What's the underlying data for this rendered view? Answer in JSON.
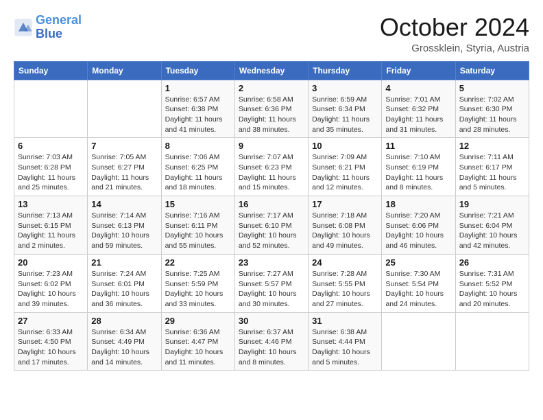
{
  "header": {
    "logo_line1": "General",
    "logo_line2": "Blue",
    "month": "October 2024",
    "location": "Grossklein, Styria, Austria"
  },
  "days_of_week": [
    "Sunday",
    "Monday",
    "Tuesday",
    "Wednesday",
    "Thursday",
    "Friday",
    "Saturday"
  ],
  "weeks": [
    [
      {
        "day": "",
        "info": ""
      },
      {
        "day": "",
        "info": ""
      },
      {
        "day": "1",
        "info": "Sunrise: 6:57 AM\nSunset: 6:38 PM\nDaylight: 11 hours and 41 minutes."
      },
      {
        "day": "2",
        "info": "Sunrise: 6:58 AM\nSunset: 6:36 PM\nDaylight: 11 hours and 38 minutes."
      },
      {
        "day": "3",
        "info": "Sunrise: 6:59 AM\nSunset: 6:34 PM\nDaylight: 11 hours and 35 minutes."
      },
      {
        "day": "4",
        "info": "Sunrise: 7:01 AM\nSunset: 6:32 PM\nDaylight: 11 hours and 31 minutes."
      },
      {
        "day": "5",
        "info": "Sunrise: 7:02 AM\nSunset: 6:30 PM\nDaylight: 11 hours and 28 minutes."
      }
    ],
    [
      {
        "day": "6",
        "info": "Sunrise: 7:03 AM\nSunset: 6:28 PM\nDaylight: 11 hours and 25 minutes."
      },
      {
        "day": "7",
        "info": "Sunrise: 7:05 AM\nSunset: 6:27 PM\nDaylight: 11 hours and 21 minutes."
      },
      {
        "day": "8",
        "info": "Sunrise: 7:06 AM\nSunset: 6:25 PM\nDaylight: 11 hours and 18 minutes."
      },
      {
        "day": "9",
        "info": "Sunrise: 7:07 AM\nSunset: 6:23 PM\nDaylight: 11 hours and 15 minutes."
      },
      {
        "day": "10",
        "info": "Sunrise: 7:09 AM\nSunset: 6:21 PM\nDaylight: 11 hours and 12 minutes."
      },
      {
        "day": "11",
        "info": "Sunrise: 7:10 AM\nSunset: 6:19 PM\nDaylight: 11 hours and 8 minutes."
      },
      {
        "day": "12",
        "info": "Sunrise: 7:11 AM\nSunset: 6:17 PM\nDaylight: 11 hours and 5 minutes."
      }
    ],
    [
      {
        "day": "13",
        "info": "Sunrise: 7:13 AM\nSunset: 6:15 PM\nDaylight: 11 hours and 2 minutes."
      },
      {
        "day": "14",
        "info": "Sunrise: 7:14 AM\nSunset: 6:13 PM\nDaylight: 10 hours and 59 minutes."
      },
      {
        "day": "15",
        "info": "Sunrise: 7:16 AM\nSunset: 6:11 PM\nDaylight: 10 hours and 55 minutes."
      },
      {
        "day": "16",
        "info": "Sunrise: 7:17 AM\nSunset: 6:10 PM\nDaylight: 10 hours and 52 minutes."
      },
      {
        "day": "17",
        "info": "Sunrise: 7:18 AM\nSunset: 6:08 PM\nDaylight: 10 hours and 49 minutes."
      },
      {
        "day": "18",
        "info": "Sunrise: 7:20 AM\nSunset: 6:06 PM\nDaylight: 10 hours and 46 minutes."
      },
      {
        "day": "19",
        "info": "Sunrise: 7:21 AM\nSunset: 6:04 PM\nDaylight: 10 hours and 42 minutes."
      }
    ],
    [
      {
        "day": "20",
        "info": "Sunrise: 7:23 AM\nSunset: 6:02 PM\nDaylight: 10 hours and 39 minutes."
      },
      {
        "day": "21",
        "info": "Sunrise: 7:24 AM\nSunset: 6:01 PM\nDaylight: 10 hours and 36 minutes."
      },
      {
        "day": "22",
        "info": "Sunrise: 7:25 AM\nSunset: 5:59 PM\nDaylight: 10 hours and 33 minutes."
      },
      {
        "day": "23",
        "info": "Sunrise: 7:27 AM\nSunset: 5:57 PM\nDaylight: 10 hours and 30 minutes."
      },
      {
        "day": "24",
        "info": "Sunrise: 7:28 AM\nSunset: 5:55 PM\nDaylight: 10 hours and 27 minutes."
      },
      {
        "day": "25",
        "info": "Sunrise: 7:30 AM\nSunset: 5:54 PM\nDaylight: 10 hours and 24 minutes."
      },
      {
        "day": "26",
        "info": "Sunrise: 7:31 AM\nSunset: 5:52 PM\nDaylight: 10 hours and 20 minutes."
      }
    ],
    [
      {
        "day": "27",
        "info": "Sunrise: 6:33 AM\nSunset: 4:50 PM\nDaylight: 10 hours and 17 minutes."
      },
      {
        "day": "28",
        "info": "Sunrise: 6:34 AM\nSunset: 4:49 PM\nDaylight: 10 hours and 14 minutes."
      },
      {
        "day": "29",
        "info": "Sunrise: 6:36 AM\nSunset: 4:47 PM\nDaylight: 10 hours and 11 minutes."
      },
      {
        "day": "30",
        "info": "Sunrise: 6:37 AM\nSunset: 4:46 PM\nDaylight: 10 hours and 8 minutes."
      },
      {
        "day": "31",
        "info": "Sunrise: 6:38 AM\nSunset: 4:44 PM\nDaylight: 10 hours and 5 minutes."
      },
      {
        "day": "",
        "info": ""
      },
      {
        "day": "",
        "info": ""
      }
    ]
  ]
}
